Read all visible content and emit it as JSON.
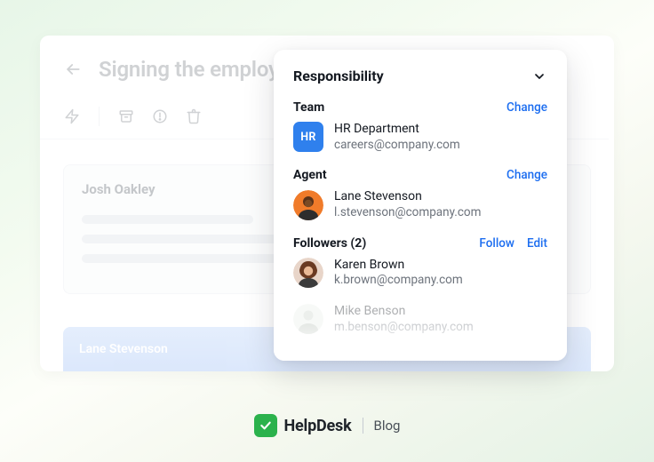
{
  "ticket": {
    "title": "Signing the employme",
    "author": "Josh Oakley",
    "reply_author": "Lane Stevenson"
  },
  "panel": {
    "title": "Responsibility",
    "team_label": "Team",
    "team_action": "Change",
    "team": {
      "badge": "HR",
      "name": "HR Department",
      "sub": "careers@company.com"
    },
    "agent_label": "Agent",
    "agent_action": "Change",
    "agent": {
      "name": "Lane Stevenson",
      "sub": "l.stevenson@company.com"
    },
    "followers_label": "Followers (2)",
    "followers_follow": "Follow",
    "followers_edit": "Edit",
    "followers": [
      {
        "name": "Karen Brown",
        "sub": "k.brown@company.com"
      },
      {
        "name": "Mike Benson",
        "sub": "m.benson@company.com"
      }
    ]
  },
  "footer": {
    "brand": "HelpDesk",
    "section": "Blog"
  }
}
